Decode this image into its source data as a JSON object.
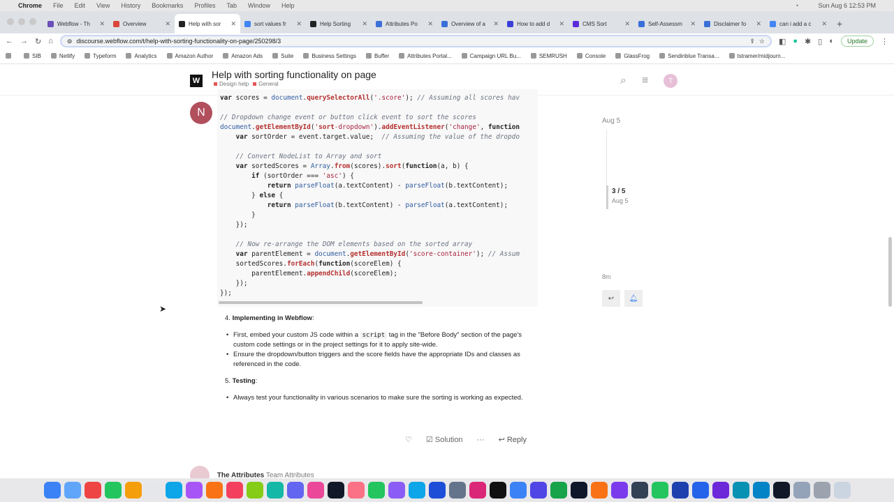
{
  "menubar": {
    "app": "Chrome",
    "items": [
      "File",
      "Edit",
      "View",
      "History",
      "Bookmarks",
      "Profiles",
      "Tab",
      "Window",
      "Help"
    ],
    "datetime": "Sun Aug 6  12:53 PM"
  },
  "tabs": [
    {
      "label": "Webflow - Th",
      "color": "#6b4fbb"
    },
    {
      "label": "Overview",
      "color": "#d9453b"
    },
    {
      "label": "Help with sor",
      "color": "#222222",
      "active": true
    },
    {
      "label": "sort values fr",
      "color": "#4285f4"
    },
    {
      "label": "Help Sorting",
      "color": "#222222"
    },
    {
      "label": "Attributes Po",
      "color": "#3a6fd8"
    },
    {
      "label": "Overview of a",
      "color": "#3a6fd8"
    },
    {
      "label": "How to add d",
      "color": "#3b3fd8"
    },
    {
      "label": "CMS Sort",
      "color": "#5a2dd8"
    },
    {
      "label": "Self-Assessm",
      "color": "#3a6fd8"
    },
    {
      "label": "Disclaimer fo",
      "color": "#3a6fd8"
    },
    {
      "label": "can i add a c",
      "color": "#4285f4"
    }
  ],
  "address": {
    "url": "discourse.webflow.com/t/help-with-sorting-functionality-on-page/250298/3",
    "update_label": "Update"
  },
  "bookmarks": [
    "SIB",
    "Netlify",
    "Typeform",
    "Analytics",
    "Amazon Author",
    "Amazon Ads",
    "Suite",
    "Business Settings",
    "Buffer",
    "Attributes Portal...",
    "Campaign URL Bu...",
    "SEMRUSH",
    "Console",
    "GlassFrog",
    "Sendinblue Transa...",
    "tstramer/midjourn..."
  ],
  "header": {
    "title": "Help with sorting functionality on page",
    "categories": [
      "Design help",
      "General"
    ],
    "user_initial": "T"
  },
  "post": {
    "author_initial": "N",
    "code_lines": [
      "var scores = document.querySelectorAll('.score'); // Assuming all scores hav",
      "",
      "// Dropdown change event or button click event to sort the scores",
      "document.getElementById('sort-dropdown').addEventListener('change', function",
      "    var sortOrder = event.target.value;  // Assuming the value of the dropdo",
      "",
      "    // Convert NodeList to Array and sort",
      "    var sortedScores = Array.from(scores).sort(function(a, b) {",
      "        if (sortOrder === 'asc') {",
      "            return parseFloat(a.textContent) - parseFloat(b.textContent);",
      "        } else {",
      "            return parseFloat(b.textContent) - parseFloat(a.textContent);",
      "        }",
      "    });",
      "",
      "    // Now re-arrange the DOM elements based on the sorted array",
      "    var parentElement = document.getElementById('score-container'); // Assum",
      "    sortedScores.forEach(function(scoreElem) {",
      "        parentElement.appendChild(scoreElem);",
      "    });",
      "});"
    ],
    "step4_num": "4.",
    "step4_title": "Implementing in Webflow",
    "step4_colon": ":",
    "step4_b1_pre": "First, embed your custom JS code within a ",
    "step4_b1_code": "script",
    "step4_b1_post": " tag in the \"Before Body\" section of the page's custom code settings or in the project settings for it to apply site-wide.",
    "step4_b2": "Ensure the dropdown/button triggers and the score fields have the appropriate IDs and classes as referenced in the code.",
    "step5_num": "5.",
    "step5_title": "Testing",
    "step5_colon": ":",
    "step5_b1": "Always test your functionality in various scenarios to make sure the sorting is working as expected.",
    "actions": {
      "solution": "Solution",
      "reply": "Reply"
    }
  },
  "timeline": {
    "top_date": "Aug 5",
    "position": "3 / 5",
    "position_date": "Aug 5",
    "bottom": "8m"
  },
  "next_post": {
    "author": "The Attributes",
    "team": "Team Attributes"
  }
}
